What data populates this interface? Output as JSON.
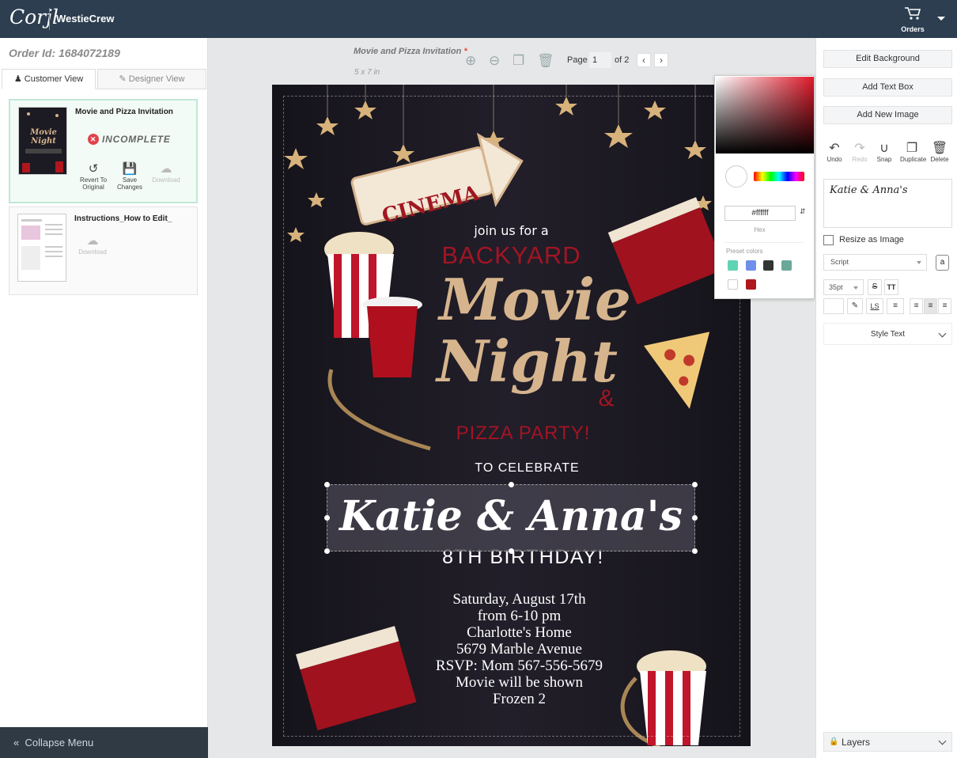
{
  "topbar": {
    "logo": "Corjl",
    "brand": "WestieCrew",
    "orders_label": "Orders"
  },
  "sidebar": {
    "order_id": "Order Id: 1684072189",
    "tabs": [
      "Customer View",
      "Designer View"
    ],
    "items": [
      {
        "title": "Movie and Pizza Invitation",
        "status": "INCOMPLETE",
        "actions": [
          "Revert To Original",
          "Save Changes",
          "Download"
        ]
      },
      {
        "title": "Instructions_How to Edit_",
        "actions": [
          "Download"
        ]
      }
    ],
    "collapse_label": "Collapse Menu"
  },
  "document": {
    "name": "Movie and Pizza Invitation",
    "required_mark": "*",
    "size": "5 x 7 in",
    "page_label": "Page",
    "page_current": "1",
    "page_of": "of 2"
  },
  "invitation": {
    "cinema": "CINEMA",
    "join": "join us for a",
    "backyard": "BACKYARD",
    "movie": "Movie",
    "night": "Night",
    "amp": "&",
    "pizza": "PIZZA PARTY!",
    "celebrate": "TO CELEBRATE",
    "name": "Katie & Anna's",
    "birthday": "8TH BIRTHDAY!",
    "details": [
      "Saturday, August 17th",
      "from 6-10 pm",
      "Charlotte's Home",
      "5679 Marble Avenue",
      "RSVP: Mom 567-556-5679",
      "Movie will be shown",
      "Frozen 2"
    ]
  },
  "color_picker": {
    "hex": "#ffffff",
    "hex_label": "Hex",
    "preset_label": "Preset colors",
    "presets": [
      "#5fd3b3",
      "#6f8fe8",
      "#333333",
      "#6aa89a",
      "#ffffff",
      "#b0161e"
    ]
  },
  "right_panel": {
    "buttons": [
      "Edit Background",
      "Add Text Box",
      "Add New Image"
    ],
    "actions": [
      "Undo",
      "Redo",
      "Snap",
      "Duplicate",
      "Delete"
    ],
    "text_value": "Katie & Anna's",
    "resize_label": "Resize as Image",
    "font": "Script",
    "font_size": "35pt",
    "style_text": "Style Text",
    "layers": "Layers"
  }
}
